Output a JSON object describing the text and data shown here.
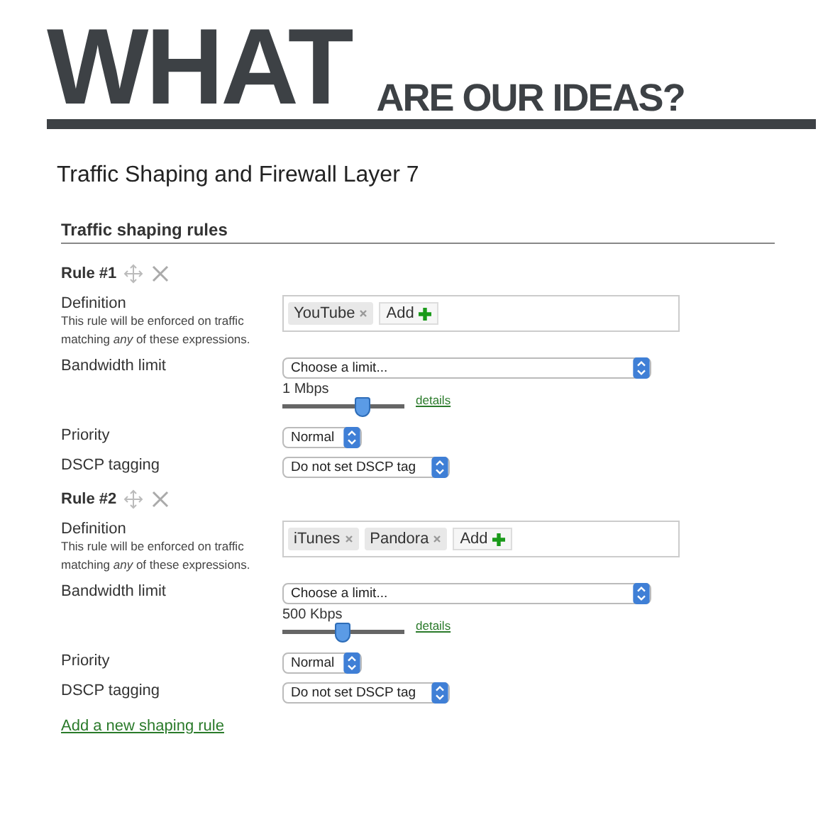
{
  "header": {
    "title": "WHAT",
    "subtitle": "ARE OUR IDEAS?"
  },
  "heading": "Traffic Shaping and Firewall Layer 7",
  "section": {
    "title": "Traffic shaping rules"
  },
  "rules": [
    {
      "title": "Rule #1",
      "definition": {
        "label": "Definition",
        "help": "This rule will be enforced on traffic matching *any* of these expressions.",
        "tokens": [
          "YouTube"
        ],
        "add_label": "Add"
      },
      "bandwidth": {
        "label": "Bandwidth limit",
        "value": "Choose a limit...",
        "reading": "1 Mbps",
        "level": 0.66,
        "link": "details"
      },
      "priority": {
        "label": "Priority",
        "value": "Normal"
      },
      "dscp": {
        "label": "DSCP tagging",
        "value": "Do not set DSCP tag"
      }
    },
    {
      "title": "Rule #2",
      "definition": {
        "label": "Definition",
        "help": "This rule will be enforced on traffic matching *any* of these expressions.",
        "tokens": [
          "iTunes",
          "Pandora"
        ],
        "add_label": "Add"
      },
      "bandwidth": {
        "label": "Bandwidth limit",
        "value": "Choose a limit...",
        "reading": "500 Kbps",
        "level": 0.49,
        "link": "details"
      },
      "priority": {
        "label": "Priority",
        "value": "Normal"
      },
      "dscp": {
        "label": "DSCP tagging",
        "value": "Do not set DSCP tag"
      }
    }
  ],
  "add_rule": "Add a new shaping rule"
}
